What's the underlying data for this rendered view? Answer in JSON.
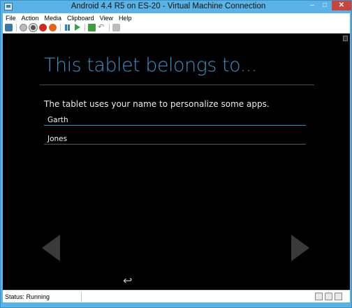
{
  "window": {
    "title": "Android 4.4 R5 on ES-20 - Virtual Machine Connection",
    "controls": {
      "minimize": "–",
      "maximize": "□",
      "close": "✕"
    }
  },
  "menu": {
    "items": [
      "File",
      "Action",
      "Media",
      "Clipboard",
      "View",
      "Help"
    ]
  },
  "toolbar": {
    "icons": [
      "ctrl-alt-del-icon",
      "start-icon",
      "turn-off-icon",
      "shut-down-icon",
      "save-icon",
      "pause-icon",
      "resume-icon",
      "checkpoint-icon",
      "revert-icon",
      "enhanced-session-icon"
    ],
    "revert_glyph": "↶"
  },
  "guest": {
    "heading": "This tablet belongs to...",
    "subtitle": "The tablet uses your name to personalize some apps.",
    "first_name": "Garth",
    "last_name": "Jones",
    "accent": "#3c8fc8",
    "back_glyph": "↩"
  },
  "status": {
    "text": "Status: Running",
    "tray_icons": [
      "keyboard-icon",
      "lock-icon",
      "enhanced-session-icon"
    ]
  }
}
